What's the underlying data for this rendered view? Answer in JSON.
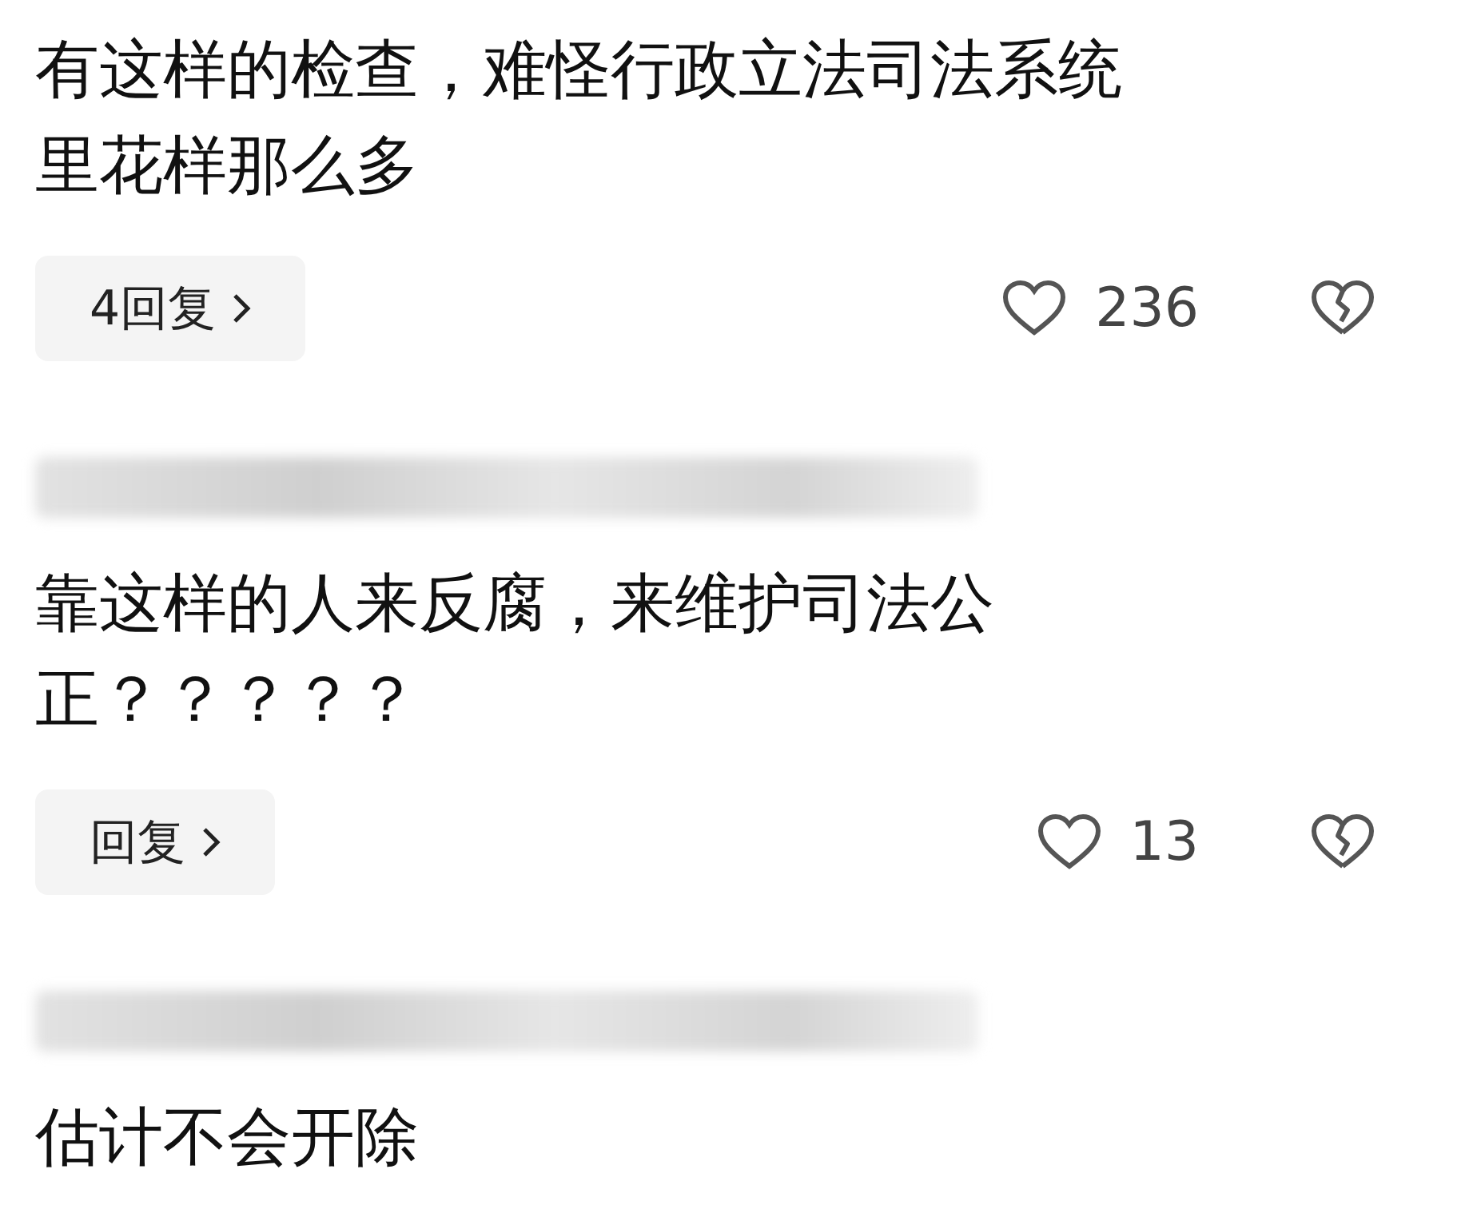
{
  "comments": [
    {
      "username_blurred": false,
      "lines": [
        "有这样的检查，难怪行政立法司法系统",
        "里花样那么多"
      ],
      "reply_label": "4回复",
      "likes": "236"
    },
    {
      "username_blurred": true,
      "lines": [
        "靠这样的人来反腐，来维护司法公",
        "正？？？？？"
      ],
      "reply_label": "回复",
      "likes": "13"
    },
    {
      "username_blurred": true,
      "lines": [
        "估计不会开除"
      ]
    }
  ]
}
